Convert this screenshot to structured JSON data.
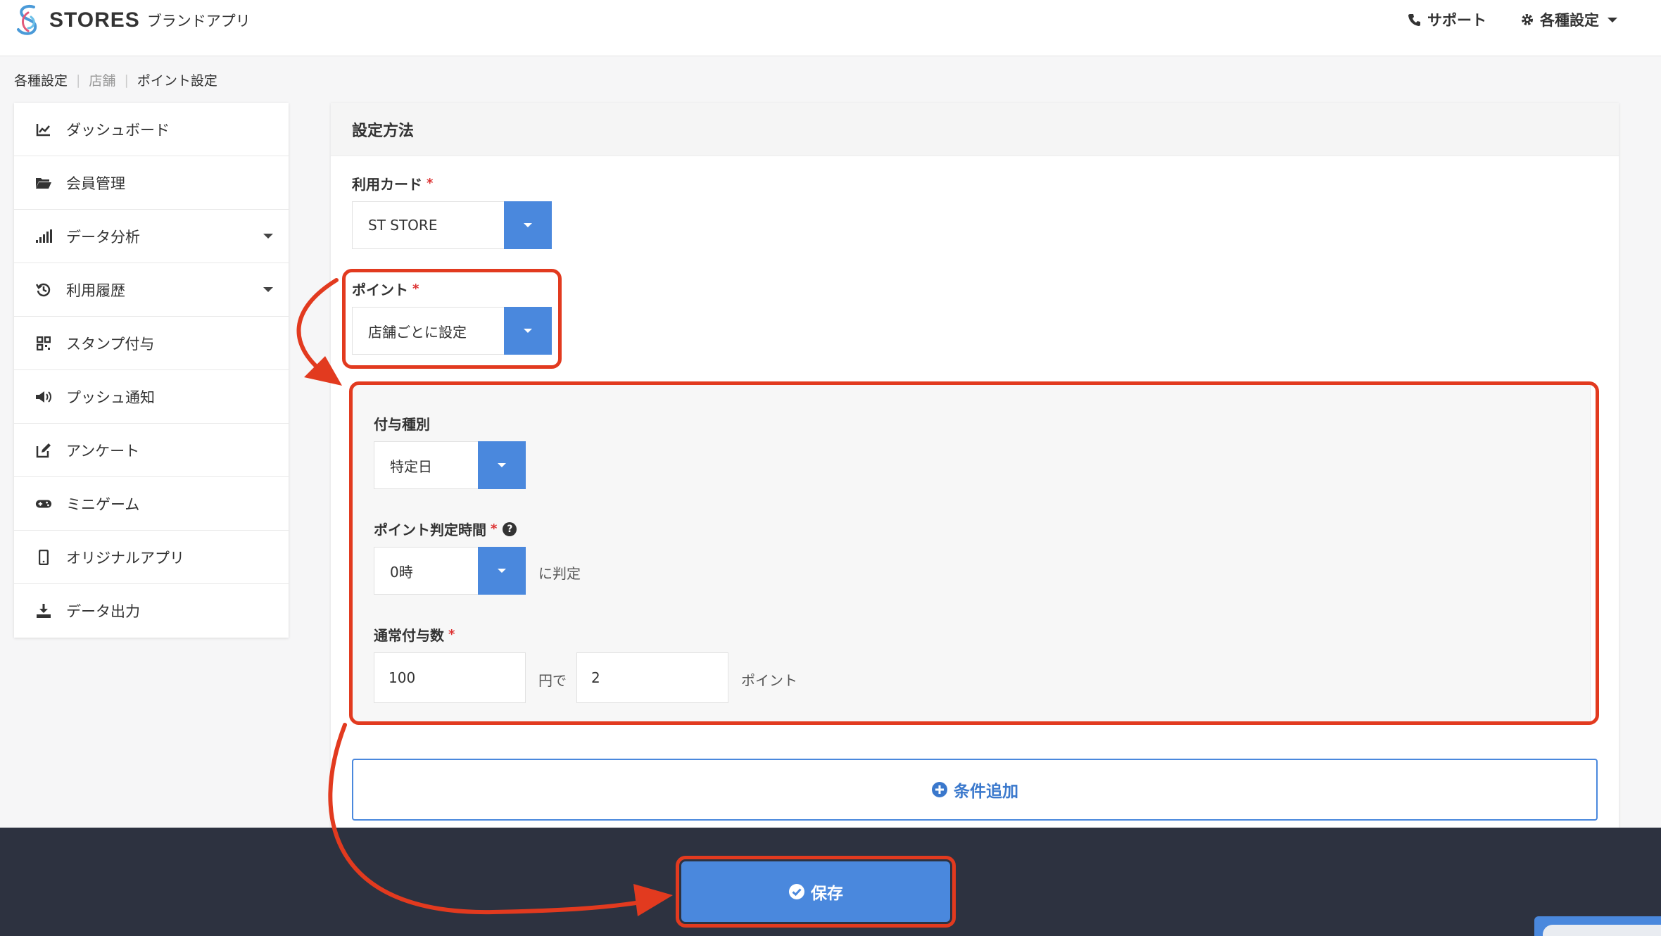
{
  "header": {
    "logo_text": "STORES",
    "logo_sub": "ブランドアプリ",
    "support_label": "サポート",
    "settings_label": "各種設定"
  },
  "breadcrumb": [
    "各種設定",
    "店舗",
    "ポイント設定"
  ],
  "sidebar": {
    "items": [
      {
        "label": "ダッシュボード",
        "icon": "chart-line-icon",
        "has_caret": false
      },
      {
        "label": "会員管理",
        "icon": "folder-open-icon",
        "has_caret": false
      },
      {
        "label": "データ分析",
        "icon": "signal-bars-icon",
        "has_caret": true
      },
      {
        "label": "利用履歴",
        "icon": "history-icon",
        "has_caret": true
      },
      {
        "label": "スタンプ付与",
        "icon": "qr-code-icon",
        "has_caret": false
      },
      {
        "label": "プッシュ通知",
        "icon": "megaphone-icon",
        "has_caret": false
      },
      {
        "label": "アンケート",
        "icon": "edit-icon",
        "has_caret": false
      },
      {
        "label": "ミニゲーム",
        "icon": "gamepad-icon",
        "has_caret": false
      },
      {
        "label": "オリジナルアプリ",
        "icon": "mobile-icon",
        "has_caret": false
      },
      {
        "label": "データ出力",
        "icon": "download-icon",
        "has_caret": false
      }
    ]
  },
  "panel": {
    "title": "設定方法",
    "card_label": "利用カード",
    "card_value": "ST STORE",
    "point_label": "ポイント",
    "point_value": "店舗ごとに設定",
    "grant_type_label": "付与種別",
    "grant_type_value": "特定日",
    "judge_time_label": "ポイント判定時間",
    "judge_time_value": "0時",
    "judge_suffix": "に判定",
    "normal_grant_label": "通常付与数",
    "yen_value": "100",
    "yen_suffix": "円で",
    "point_amount_value": "2",
    "point_suffix": "ポイント",
    "required_mark": "*",
    "add_condition_label": "条件追加"
  },
  "footer": {
    "save_label": "保存"
  },
  "colors": {
    "accent": "#4a88dd",
    "annotation": "#e23a1f",
    "footer_bg": "#2d3240"
  }
}
